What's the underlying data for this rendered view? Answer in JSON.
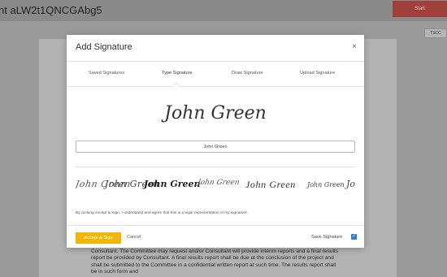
{
  "header": {
    "doc_title": "nt aLW2t1QNCGAbg5",
    "start_label": "Start",
    "tag_label": "TSCC"
  },
  "document": {
    "text": "Consultant. The Committee may request and/or Consultant will provide interim reports and a final results report be provided by Consultant. A final results report shall be due at the conclusion of the project and shall be submitted to the Committee in a confidential written report at such time. The results report shall be in such form and"
  },
  "modal": {
    "title": "Add Signature",
    "close_glyph": "×",
    "tabs": [
      "Saved Signatures",
      "Type Signature",
      "Draw Signature",
      "Upload Signature"
    ],
    "active_tab": "Type Signature",
    "preview_text": "John Green",
    "input_value": "John Green",
    "style_options": [
      "John Green",
      "John Green",
      "John Green",
      "John Green",
      "John Green",
      "John Green",
      "Jo"
    ],
    "disclaimer": "By clicking Accept & Sign, I understand and agree that this is a legal representation of my signature.",
    "accept_label": "Accept & Sign",
    "cancel_label": "Cancel",
    "save_label": "Save Signature",
    "save_checked": true,
    "check_glyph": "✓",
    "accent_color": "#f2b705",
    "checkbox_color": "#2d7fd3"
  }
}
